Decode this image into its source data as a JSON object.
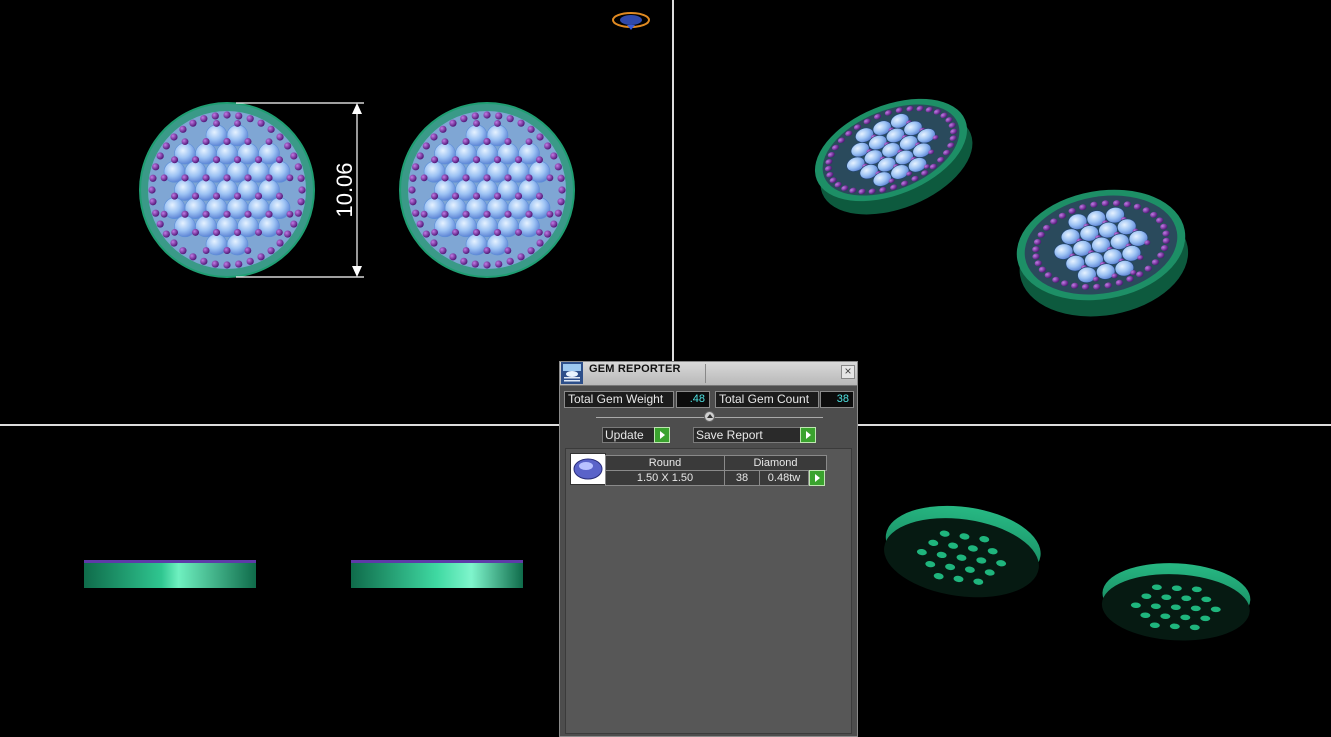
{
  "dimension": {
    "value": "10.06"
  },
  "gem_reporter": {
    "title": "GEM REPORTER",
    "close_symbol": "×",
    "total_gem_weight_label": "Total Gem Weight",
    "total_gem_weight_value": ".48",
    "total_gem_count_label": "Total Gem Count",
    "total_gem_count_value": "38",
    "update_label": "Update",
    "save_report_label": "Save Report",
    "gems": [
      {
        "shape": "Round",
        "type": "Diamond",
        "size": "1.50 X 1.50",
        "count": "38",
        "weight": "0.48tw"
      }
    ]
  },
  "colors": {
    "background": "#000000",
    "panel": "#4d4d4d",
    "metal": "#1f9e72",
    "gem": "#9dc3f4",
    "prong": "#7a2ea6",
    "accent_value": "#4fe3e3",
    "go_button": "#3aa32e"
  },
  "icons": {
    "app": "gem-reporter-icon",
    "close": "close-icon",
    "go": "play-arrow-icon",
    "slider": "slider-knob-icon",
    "gem_thumb": "oval-gem-icon"
  }
}
